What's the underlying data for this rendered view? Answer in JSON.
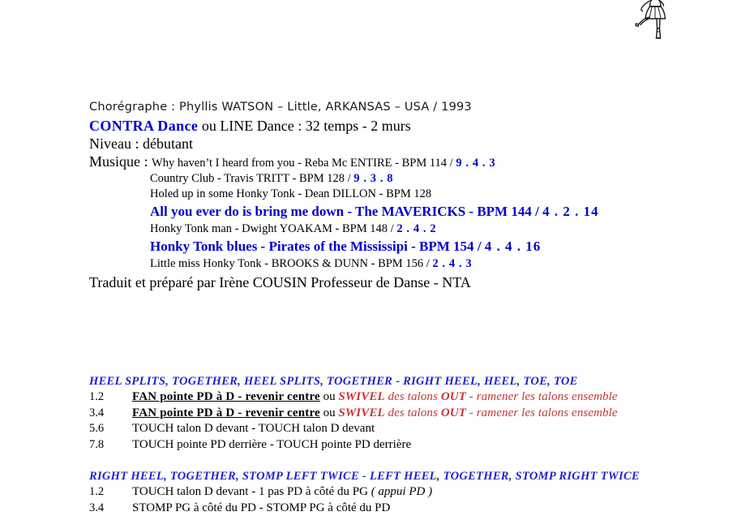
{
  "document": {
    "illustration": "dancer-line-drawing",
    "header": {
      "choreographe": "Chorégraphe : Phyllis  WATSON – Little, ARKANSAS – USA  /  1993",
      "dance_type_keyword": "CONTRA  Dance",
      "dance_type_rest": " ou  LINE  Dance : 32  temps - 2  murs",
      "niveau": "Niveau : débutant",
      "musique_label": "Musique : ",
      "traduit": "Traduit et préparé par Irène COUSIN Professeur de Danse - NTA"
    },
    "songs": [
      {
        "title": "Why haven’t I heard from you - Reba  Mc ENTIRE - BPM  114",
        "separator": "   /   ",
        "code": "9 . 4 . 3",
        "style": "plain"
      },
      {
        "title": "Country Club - Travis  TRITT - BPM  128",
        "separator": "   /   ",
        "code": "9 . 3 . 8",
        "style": "plain"
      },
      {
        "title": "Holed up in some Honky Tonk - Dean  DILLON - BPM  128",
        "separator": "",
        "code": "",
        "style": "plain"
      },
      {
        "title": "All you ever do is bring me down - The  MAVERICKS - BPM  144",
        "separator": "   /   ",
        "code": "4 . 2 . 14",
        "style": "accent"
      },
      {
        "title": "Honky Tonk man - Dwight YOAKAM - BPM  148",
        "separator": "   /   ",
        "code": "2 . 4 . 2",
        "style": "plain"
      },
      {
        "title": "Honky Tonk blues - Pirates of the Mississipi - BPM  154",
        "separator": "   /   ",
        "code": "4 . 4 . 16",
        "style": "accent"
      },
      {
        "title": "Little miss Honky Tonk - BROOKS  &  DUNN - BPM  156",
        "separator": "   /   ",
        "code": "2 . 4 . 3",
        "style": "plain"
      }
    ],
    "sections": [
      {
        "title": "HEEL   SPLITS, TOGETHER,  HEEL   SPLITS, TOGETHER - RIGHT  HEEL, HEEL, TOE, TOE",
        "steps": [
          {
            "num": "1.2",
            "bold_underline": "FAN  pointe  PD  à  D     -  revenir centre",
            "connector": " ou  ",
            "red_caps": "SWIVEL",
            "red_mid": " des talons ",
            "red_caps2": "OUT",
            "red_tail": " - ramener les talons ensemble",
            "plain": ""
          },
          {
            "num": "3.4",
            "bold_underline": "FAN  pointe  PD  à  D     -  revenir centre",
            "connector": " ou  ",
            "red_caps": "SWIVEL",
            "red_mid": " des talons ",
            "red_caps2": "OUT",
            "red_tail": " - ramener les talons ensemble",
            "plain": ""
          },
          {
            "num": "5.6",
            "bold_underline": "",
            "connector": "",
            "red_caps": "",
            "red_mid": "",
            "red_caps2": "",
            "red_tail": "",
            "plain": "TOUCH talon  D  devant  -  TOUCH  talon  D  devant"
          },
          {
            "num": "7.8",
            "bold_underline": "",
            "connector": "",
            "red_caps": "",
            "red_mid": "",
            "red_caps2": "",
            "red_tail": "",
            "plain": "TOUCH  pointe  PD  derrière  -  TOUCH  pointe  PD   derrière"
          }
        ]
      },
      {
        "title": "RIGHT  HEEL, TOGETHER, STOMP  LEFT  TWICE - LEFT  HEEL, TOGETHER, STOMP  RIGHT  TWICE",
        "steps": [
          {
            "num": "1.2",
            "bold_underline": "",
            "connector": "",
            "red_caps": "",
            "red_mid": "",
            "red_caps2": "",
            "red_tail": "",
            "plain": "TOUCH talon  D  devant  -  1 pas PD à côté du PG",
            "italic_tail": " ( appui  PD )"
          },
          {
            "num": "3.4",
            "bold_underline": "",
            "connector": "",
            "red_caps": "",
            "red_mid": "",
            "red_caps2": "",
            "red_tail": "",
            "plain": "STOMP  PG  à  côté  du  PD  -  STOMP  PG  à  côté  du  PD",
            "italic_tail": ""
          }
        ]
      }
    ]
  },
  "colors": {
    "accent_blue": "#0000cc",
    "section_blue": "#2222cc",
    "alt_red": "#cc3333",
    "text_black": "#000000",
    "page_background": "#ffffff"
  }
}
